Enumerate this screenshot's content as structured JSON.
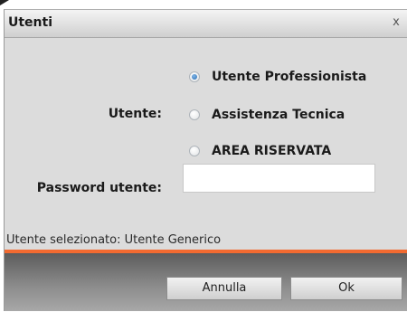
{
  "dialog": {
    "title": "Utenti",
    "close_label": "x"
  },
  "form": {
    "user_label": "Utente:",
    "user_options": [
      {
        "label": "Utente Professionista",
        "checked": true
      },
      {
        "label": "Assistenza Tecnica",
        "checked": false
      },
      {
        "label": "AREA RISERVATA",
        "checked": false
      }
    ],
    "password_label": "Password utente:",
    "password_value": ""
  },
  "status": {
    "text": "Utente selezionato: Utente Generico"
  },
  "footer": {
    "cancel_label": "Annulla",
    "ok_label": "Ok"
  },
  "colors": {
    "accent": "#f26a30",
    "radio_selected": "#2b6fb5"
  }
}
